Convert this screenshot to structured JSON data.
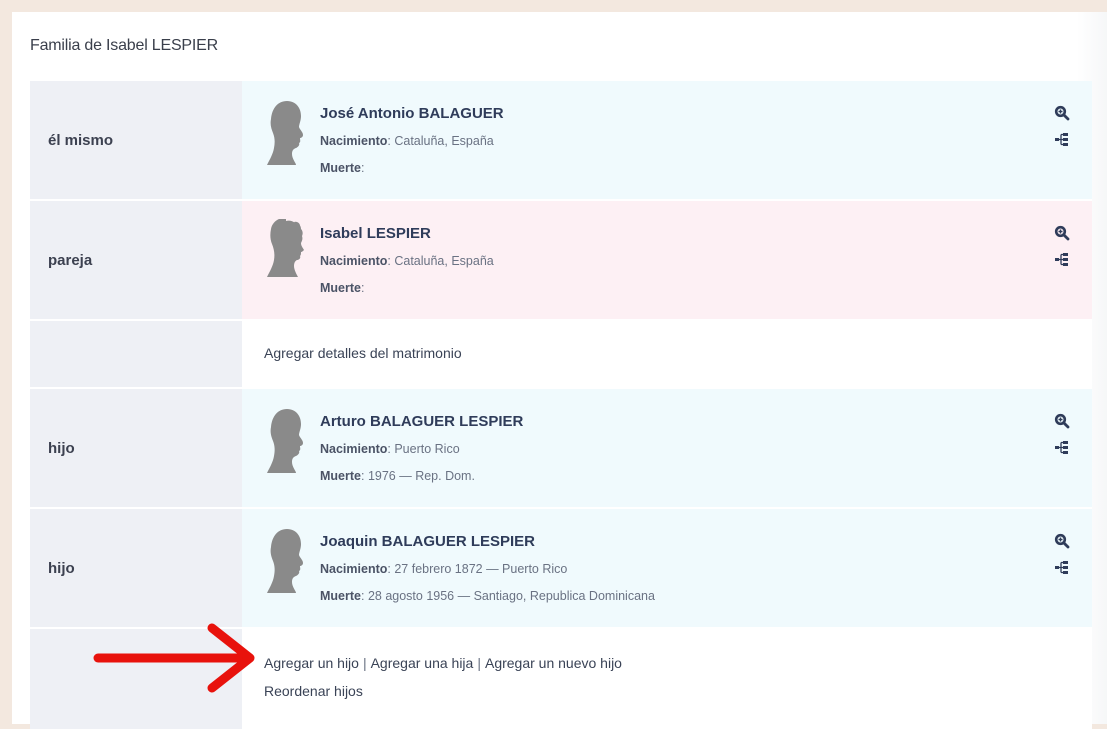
{
  "title": "Familia de Isabel LESPIER",
  "labels": {
    "birth": "Nacimiento",
    "death": "Muerte"
  },
  "people": [
    {
      "role": "él mismo",
      "name": "José Antonio BALAGUER",
      "birth": "Cataluña, España",
      "death": "",
      "gender": "male"
    },
    {
      "role": "pareja",
      "name": "Isabel LESPIER",
      "birth": "Cataluña, España",
      "death": "",
      "gender": "female"
    }
  ],
  "marriage_link": "Agregar detalles del matrimonio",
  "children": [
    {
      "role": "hijo",
      "name": "Arturo BALAGUER LESPIER",
      "birth": "Puerto Rico",
      "death": "1976 — Rep. Dom.",
      "gender": "male"
    },
    {
      "role": "hijo",
      "name": "Joaquin BALAGUER LESPIER",
      "birth": "27 febrero 1872 — Puerto Rico",
      "death": "28 agosto 1956 — Santiago, Republica Dominicana",
      "gender": "male"
    }
  ],
  "actions": {
    "add_son": "Agregar un hijo",
    "add_daughter": "Agregar una hija",
    "add_child": "Agregar un nuevo hijo",
    "reorder": "Reordenar hijos",
    "separator": "|"
  },
  "icons": {
    "zoom": "zoom-icon",
    "tree": "family-tree-icon"
  },
  "colors": {
    "male_bg": "#f0fafd",
    "female_bg": "#fdf0f4",
    "label_bg": "#eef0f5",
    "arrow": "#e8120c",
    "icon": "#2f3c5a"
  }
}
